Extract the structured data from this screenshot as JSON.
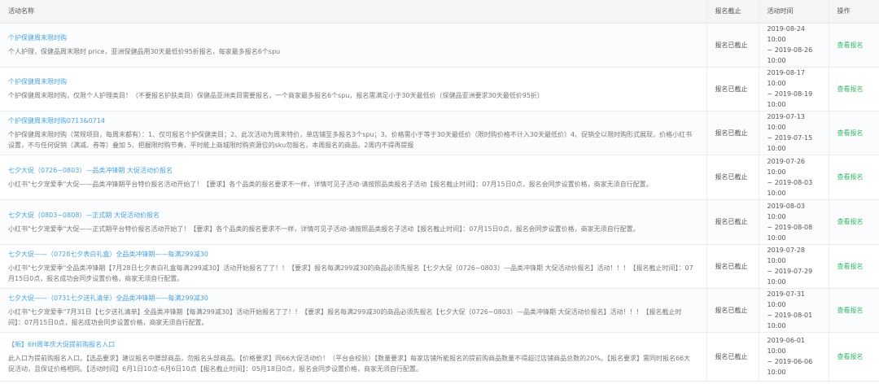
{
  "header": {
    "name": "活动名称",
    "deadline": "报名截止",
    "time": "活动时间",
    "action": "操作"
  },
  "rows": [
    {
      "title": "个护保健周末限时购",
      "desc": "个人护理，保健品周末限时 price，亚洲保健品用30天最低价95折报名，每家最多报名6个spu",
      "status": "报名已截止",
      "time": "2019-08-24 10:00\n~ 2019-08-26\n10:00",
      "action": "查看报名"
    },
    {
      "title": "个护保健周末限时购",
      "desc": "个护保健周末限时购，仅限个人护理类目！（不要报名护肤类目）保健品亚洲类目需要报名，一个商家最多报名6个spu，报名需满足小于30天最低价（保健品亚洲要求30天最低价95折）",
      "status": "报名已截止",
      "time": "2019-08-17 10:00\n~ 2019-08-19\n10:00",
      "action": "查看报名"
    },
    {
      "title": "个护保健周末限时购0713&0714",
      "desc": "个护保健周末限时购（常规项目，每周末都有）：1、仅可报名个护保健类目；2、此次活动为周末特价，单店铺至多报名3个spu；3、价格需小于等于30天最低价（限时购价格不计入30天最低价）4、促销全以限时购形式展现，价格小红书设置，不与任何促销（满减、券等）叠加 5、把握限时购节奏，平时能上商城限时购资源位的sku勿报名，本周报名的商品，2周内不得再提报",
      "status": "报名已截止",
      "time": "2019-07-13 10:00\n~ 2019-07-15\n10:00",
      "action": "查看报名"
    },
    {
      "title": "七夕大促（0726~0803）—品类冲锋期 大促活动价报名",
      "desc": "小红书\"七夕宠爱季\"大促——品类冲锋期平台特价报名活动开始了！【要求】各个品类的报名要求不一样，详情可见子活动-请按照品类报名子活动【报名截止时间】：07月15日0点，报名会同步设置价格，商家无须自行配置。",
      "status": "报名已截止",
      "time": "2019-07-26 10:00\n~ 2019-08-03\n10:00",
      "action": "查看报名"
    },
    {
      "title": "七夕大促（0803~0808）—正式期 大促活动价报名",
      "desc": "小红书\"七夕宠爱季\"大促——正式期平台特价报名活动开始了！【要求】各个品类的报名要求不一样，详情可见子活动-请按照品类报名子活动【报名截止时间】：07月15日0点，报名会同步设置价格，商家无须自行配置。",
      "status": "报名已截止",
      "time": "2019-08-03 10:00\n~ 2019-08-08\n10:00",
      "action": "查看报名"
    },
    {
      "title": "七夕大促——（0728七夕表白礼盒）全品类冲锋期——每满299减30",
      "desc": "小红书\"七夕宠爱季\"全品类冲锋期【7月28日七夕表白礼盒每满299减30】活动开始报名了了！！【要求】报名每满299减30的商品必须先报名【七夕大促（0726~0803）—品类冲锋期 大促活动价报名】活动！！！【报名截止时间】：07月15日0点，报名成功会同步设置价格，商家无须自行配置。",
      "status": "报名已截止",
      "time": "2019-07-28 10:00\n~ 2019-07-29\n10:00",
      "action": "查看报名"
    },
    {
      "title": "七夕大促——（0731七夕送礼清单）全品类冲锋期——每满299减30",
      "desc": "小红书\"七夕宠爱季\"7月31日【七夕送礼清单】全品类冲锋期【每满299减30】活动开始报名了了！！【要求】报名每满299减30的商品必须先报名【七夕大促（0726~0803）—品类冲锋期 大促活动价报名】活动！！！【报名截止时间】：07月15日0点，报名成功会同步设置价格，商家无须自行配置。",
      "status": "报名已截止",
      "time": "2019-07-31 10:00\n~ 2019-08-01\n10:00",
      "action": "查看报名"
    },
    {
      "title": "【新】6H周年庆大促提前购报名入口",
      "desc": "此入口为提前购报名入口。【选品要求】建议报名中腰部商品，勿报名头部商品。【价格要求】同66大促活动价！（平台会校验）【数量要求】每家店铺所能报名的提前购商品数量不得超过店铺商品总数的20%。【报名要求】需同时报名66大促活动，且保证价格相同。【活动时间】6月1日10点-6月6日10点【报名截止时间】：05月18日0点，报名会同步设置价格，商家无须自行配置。",
      "status": "报名已截止",
      "time": "2019-06-01 10:00\n~ 2019-06-06\n10:00",
      "action": "查看报名"
    }
  ]
}
